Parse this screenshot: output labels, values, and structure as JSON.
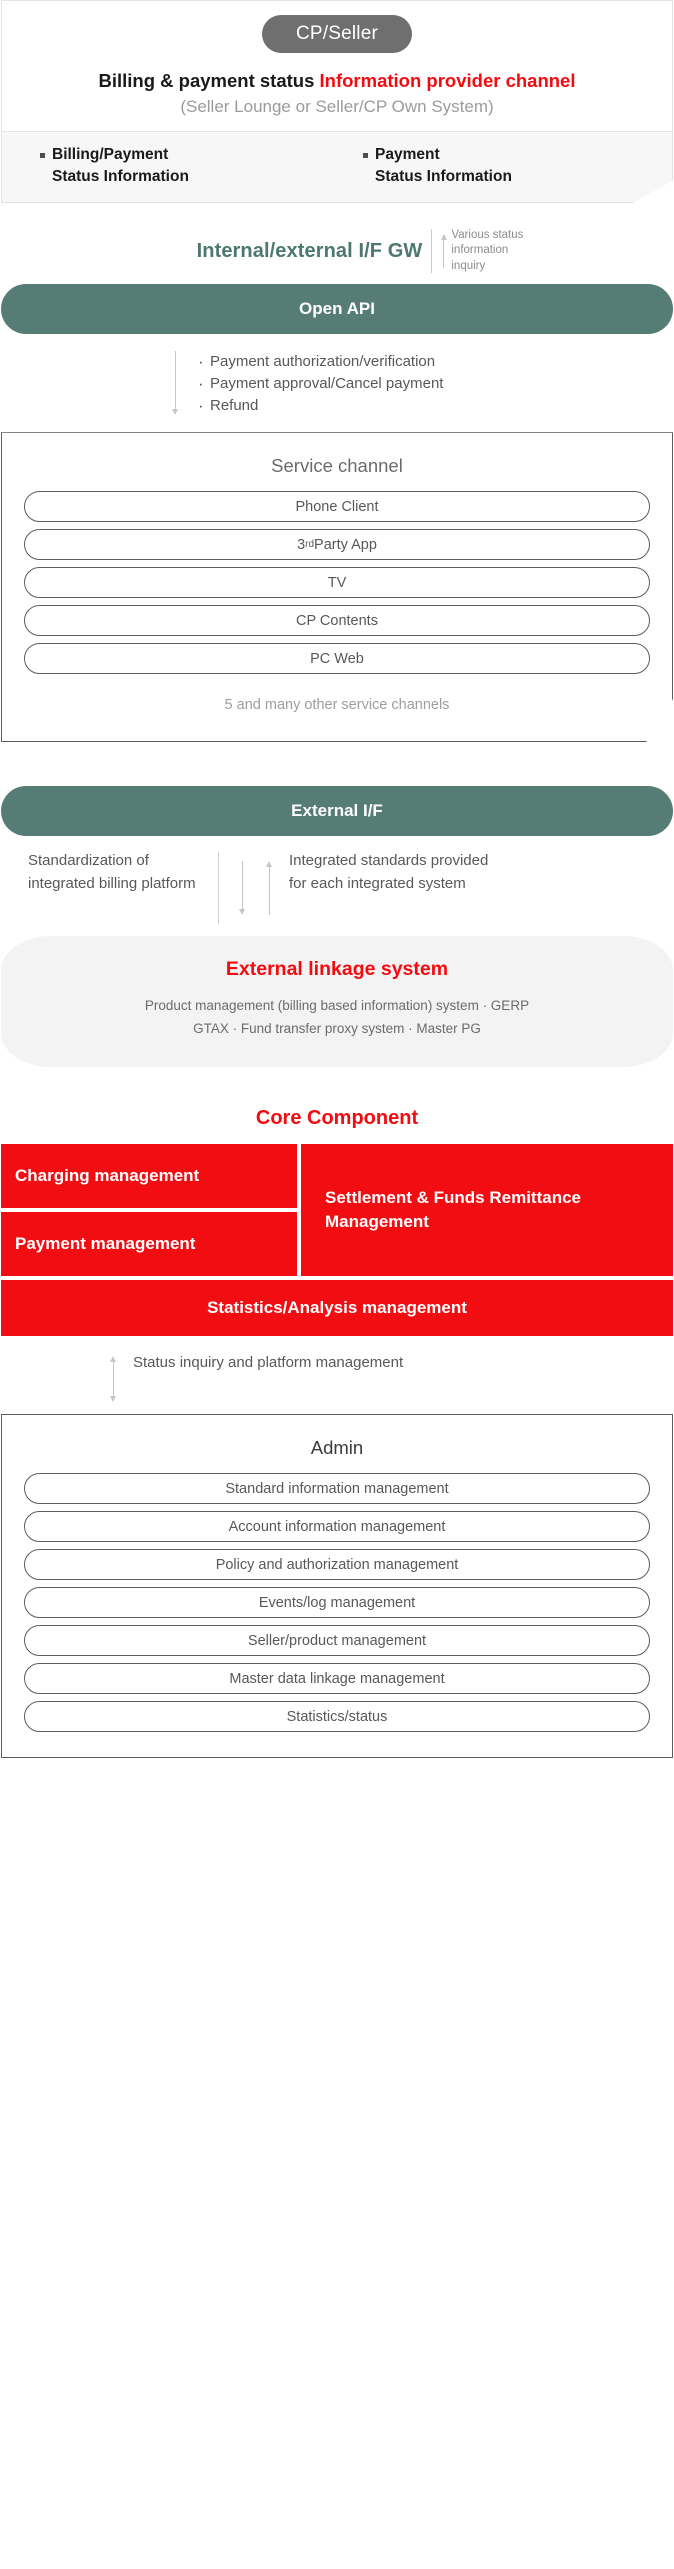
{
  "colors": {
    "accent_red": "#f50a10",
    "core_red": "#f20d13",
    "teal": "#567d75",
    "teal_text": "#4d7870",
    "grey_pill": "#6f6f6f",
    "band_bg": "#f7f7f7",
    "linkage_bg": "#f3f3f3"
  },
  "cp_seller": {
    "pill_label": "CP/Seller",
    "title_plain": "Billing & payment status ",
    "title_accent": "Information provider channel",
    "subtitle": "(Seller Lounge or Seller/CP Own System)",
    "status_columns": [
      {
        "line1": "Billing/Payment",
        "line2": "Status Information"
      },
      {
        "line1": "Payment",
        "line2": "Status Information"
      }
    ]
  },
  "gateway": {
    "title": "Internal/external I/F GW",
    "note_line1": "Various status",
    "note_line2": "information",
    "note_line3": "inquiry",
    "api_bar_label": "Open API",
    "operations": [
      "Payment authorization/verification",
      "Payment approval/Cancel payment",
      "Refund"
    ]
  },
  "service_channel": {
    "heading": "Service channel",
    "items": [
      {
        "text": "Phone Client",
        "sup": ""
      },
      {
        "text_pre": "3",
        "sup": "rd",
        "text_post": " Party App"
      },
      {
        "text": "TV",
        "sup": ""
      },
      {
        "text": "CP Contents",
        "sup": ""
      },
      {
        "text": "PC Web",
        "sup": ""
      }
    ],
    "footer": "5 and many other service channels"
  },
  "external_if": {
    "bar_label": "External I/F",
    "note_left": "Standardization of integrated billing platform",
    "note_right": "Integrated standards provided for each integrated system"
  },
  "linkage": {
    "title": "External linkage system",
    "line1": "Product management (billing based information) system  ·  GERP",
    "line2": "GTAX  ·  Fund transfer proxy system  ·  Master PG"
  },
  "core_component": {
    "title": "Core Component",
    "left_cells": [
      "Charging management",
      "Payment management"
    ],
    "right_cell": "Settlement & Funds Remittance Management",
    "wide_cell": "Statistics/Analysis management"
  },
  "admin": {
    "note": "Status inquiry and platform management",
    "heading": "Admin",
    "items": [
      "Standard information management",
      "Account information management",
      "Policy and authorization management",
      "Events/log management",
      "Seller/product management",
      "Master data linkage management",
      "Statistics/status"
    ]
  }
}
